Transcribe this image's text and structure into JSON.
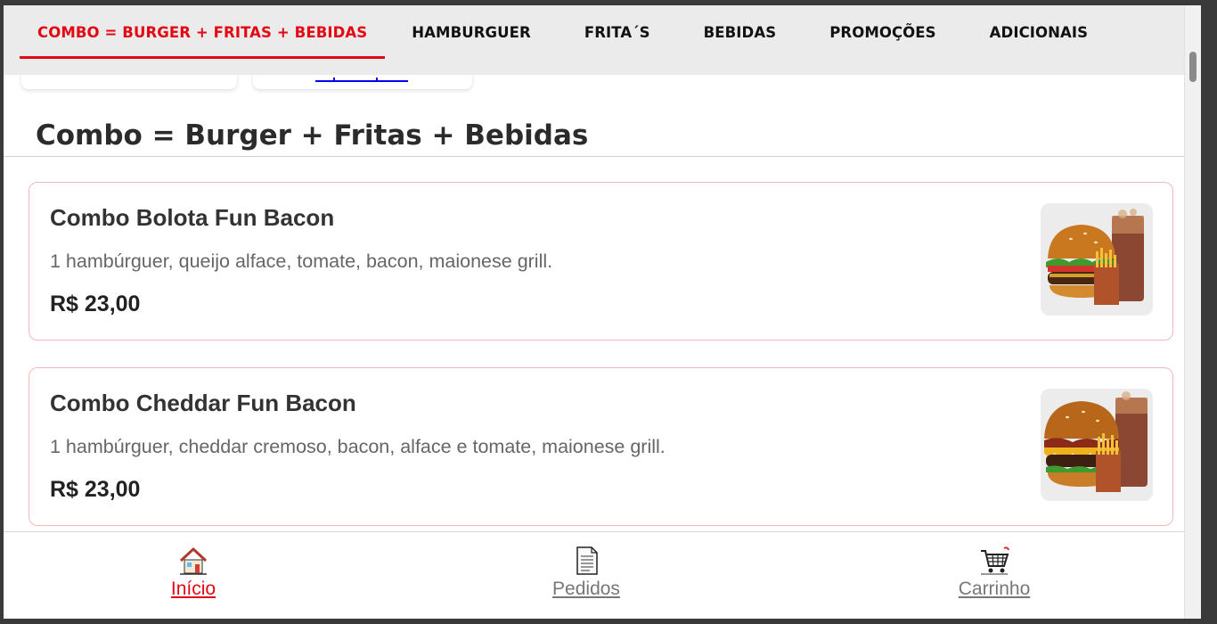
{
  "nav": {
    "tabs": [
      {
        "label": "COMBO = BURGER + FRITAS + BEBIDAS",
        "active": true
      },
      {
        "label": "HAMBURGUER",
        "active": false
      },
      {
        "label": "FRITA´S",
        "active": false
      },
      {
        "label": "BEBIDAS",
        "active": false
      },
      {
        "label": "PROMOÇÕES",
        "active": false
      },
      {
        "label": "ADICIONAIS",
        "active": false
      }
    ]
  },
  "section": {
    "title": "Combo = Burger + Fritas + Bebidas"
  },
  "products": [
    {
      "name": "Combo Bolota Fun Bacon",
      "description": "1 hambúrguer, queijo alface, tomate, bacon, maionese grill.",
      "price": "R$ 23,00",
      "image_icon": "burger-combo-image"
    },
    {
      "name": "Combo Cheddar Fun Bacon",
      "description": "1 hambúrguer, cheddar cremoso, bacon, alface e tomate, maionese grill.",
      "price": "R$ 23,00",
      "image_icon": "burger-combo-image"
    }
  ],
  "bottom_nav": {
    "items": [
      {
        "label": "Início",
        "icon": "home-icon",
        "active": true
      },
      {
        "label": "Pedidos",
        "icon": "document-icon",
        "active": false
      },
      {
        "label": "Carrinho",
        "icon": "cart-icon",
        "active": false
      }
    ]
  },
  "colors": {
    "accent": "#e30613",
    "nav_background": "#ebebeb",
    "card_border": "#f2b8b8"
  }
}
